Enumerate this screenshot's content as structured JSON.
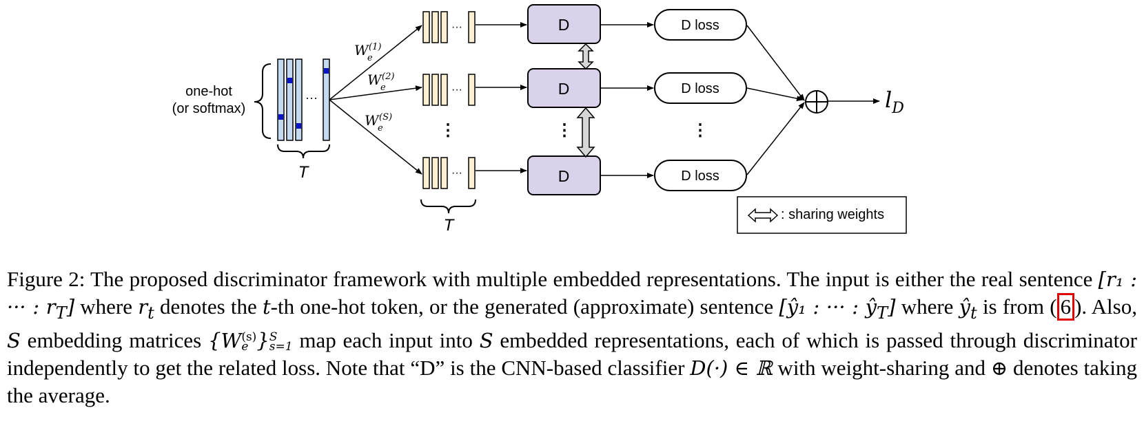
{
  "figure": {
    "input_label_line1": "one-hot",
    "input_label_line2": "(or softmax)",
    "T_label": "T",
    "weight_labels": [
      {
        "base": "W",
        "sub": "e",
        "sup": "(1)"
      },
      {
        "base": "W",
        "sub": "e",
        "sup": "(2)"
      },
      {
        "base": "W",
        "sub": "e",
        "sup": "(S)"
      }
    ],
    "ellipsis": "···",
    "vdots": "⋮",
    "discriminator_label": "D",
    "loss_label": "D loss",
    "output_base": "l",
    "output_sub": "D",
    "legend_text": ": sharing weights",
    "colors": {
      "one_hot_column": "#c5d9f1",
      "one_hot_marker": "#0a14c8",
      "embedding_column": "#fdf0d2",
      "discriminator_fill": "#d9d2ea",
      "sharing_arrow_fill": "#d6d6d6",
      "reference_box": "#e00000"
    }
  },
  "caption": {
    "p1": "Figure 2: The proposed discriminator framework with multiple embedded representations. The input is either the real sentence ",
    "m1": "[r₁ : ··· : r",
    "m1_sub": "T",
    "m1_end": "]",
    "p2": " where ",
    "m2": "r",
    "m2_sub": "t",
    "p3": " denotes the ",
    "m3": "t",
    "p4": "-th one-hot token, or the generated (approximate) sentence ",
    "m4": "[ŷ₁ : ··· : ŷ",
    "m4_sub": "T",
    "m4_end": "]",
    "p5": " where ",
    "m5": "ŷ",
    "m5_sub": "t",
    "p6": " is from (",
    "ref": "6",
    "p7": "). Also, ",
    "m6": "S",
    "p8": " embedding matrices ",
    "m7": "{W",
    "m7_sub": "e",
    "m7_sup": "(s)",
    "m7_end": "}",
    "m7_sup2": "S",
    "m7_sub2": "s=1",
    "p9": " map each input into ",
    "m8": "S",
    "p10": " embedded representations, each of which is passed through discriminator independently to get the related loss. Note that “D” is the CNN-based classifier ",
    "m9": "D(·) ∈ ℝ",
    "p11": " with weight-sharing and ",
    "m10": "⊕",
    "p12": " denotes taking the average."
  }
}
